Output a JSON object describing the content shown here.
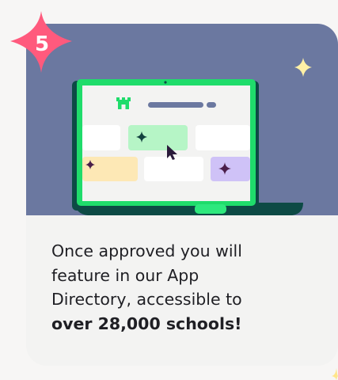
{
  "step": {
    "number": "5"
  },
  "description": {
    "line1": "Once approved you will",
    "line2": "feature in our App",
    "line3": "Directory, accessible to",
    "line4_bold": "over 28,000 schools!"
  },
  "colors": {
    "hero_background": "#6b78a0",
    "laptop_frame": "#1fdc6b",
    "laptop_dark": "#0d4a45",
    "badge": "#ff5a7d",
    "sparkle_yellow": "#fff0a6",
    "dark_star": "#4a1e4a"
  },
  "icons": [
    "castle-logo-icon",
    "cursor-arrow-icon",
    "sparkle-icon"
  ]
}
